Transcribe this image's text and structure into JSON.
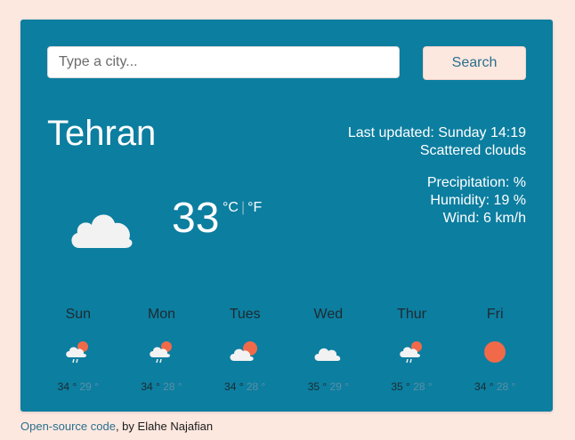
{
  "search": {
    "placeholder": "Type a city...",
    "button_label": "Search"
  },
  "current": {
    "city": "Tehran",
    "last_updated": "Last updated: Sunday 14:19",
    "description": "Scattered clouds",
    "precipitation": "Precipitation: %",
    "humidity": "Humidity: 19 %",
    "wind": "Wind: 6 km/h",
    "temperature": "33",
    "unit_c": "°C",
    "unit_sep": "|",
    "unit_f": "°F",
    "icon": "cloud-icon"
  },
  "forecast": [
    {
      "day": "Sun",
      "max": "34 °",
      "min": "29 °",
      "icon": "cloud-rain-sun-icon"
    },
    {
      "day": "Mon",
      "max": "34 °",
      "min": "28 °",
      "icon": "cloud-rain-sun-icon"
    },
    {
      "day": "Tues",
      "max": "34 °",
      "min": "28 °",
      "icon": "cloud-sun-icon"
    },
    {
      "day": "Wed",
      "max": "35 °",
      "min": "29 °",
      "icon": "cloud-icon"
    },
    {
      "day": "Thur",
      "max": "35 °",
      "min": "28 °",
      "icon": "cloud-rain-sun-icon"
    },
    {
      "day": "Fri",
      "max": "34 °",
      "min": "28 °",
      "icon": "sun-icon"
    }
  ],
  "footer": {
    "link_text": "Open-source code",
    "suffix": ", by Elahe Najafian"
  },
  "colors": {
    "page_bg": "#fde8e0",
    "card_bg": "#0c7ea0",
    "sun": "#f06a4a",
    "cloud": "#f2f2f2"
  }
}
